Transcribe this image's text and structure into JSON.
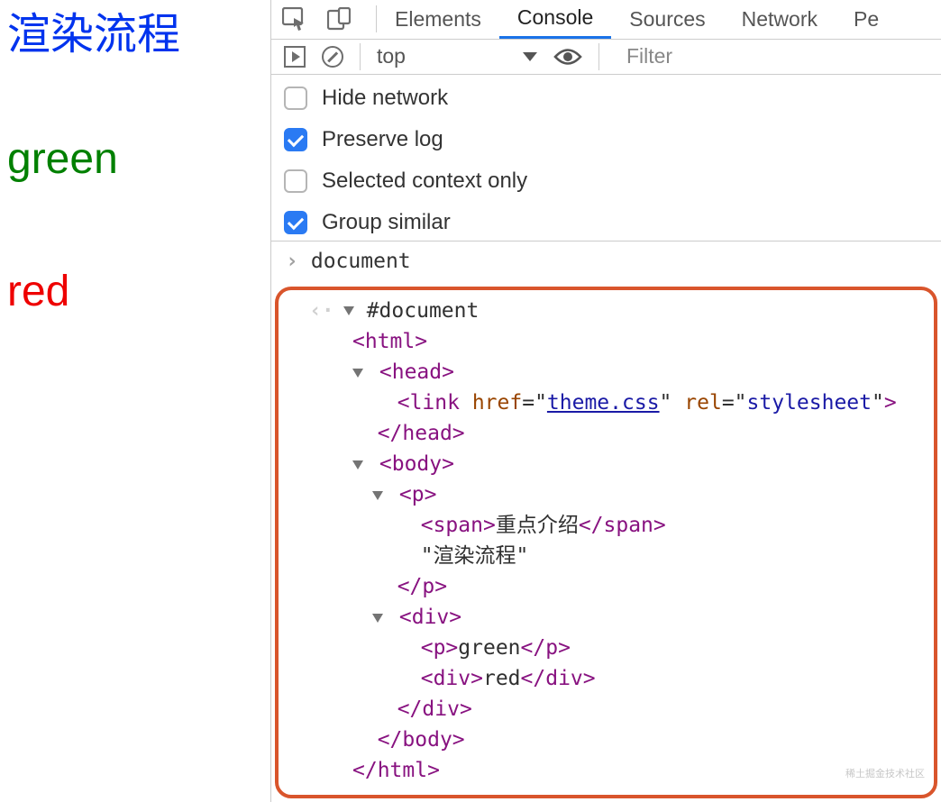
{
  "page": {
    "title": "渲染流程",
    "green": "green",
    "red": "red"
  },
  "tabs": {
    "elements": "Elements",
    "console": "Console",
    "sources": "Sources",
    "network": "Network",
    "performance": "Pe"
  },
  "subbar": {
    "context": "top",
    "filter_placeholder": "Filter"
  },
  "options": {
    "hide_network": "Hide network",
    "preserve_log": "Preserve log",
    "selected_context_only": "Selected context only",
    "group_similar": "Group similar"
  },
  "console": {
    "input": "document",
    "return_root": "#document",
    "dom": {
      "html_open": "html",
      "head_open": "head",
      "link_tag": "link",
      "link_href_attr": "href",
      "link_href_val": "theme.css",
      "link_rel_attr": "rel",
      "link_rel_val": "stylesheet",
      "head_close": "head",
      "body_open": "body",
      "p_open": "p",
      "span_open": "span",
      "span_text": "重点介绍",
      "span_close": "span",
      "p_text": "\"渲染流程\"",
      "p_close": "p",
      "div_open": "div",
      "inner_p_open": "p",
      "inner_p_text": "green",
      "inner_p_close": "p",
      "inner_div_open": "div",
      "inner_div_text": "red",
      "inner_div_close": "div",
      "div_close": "div",
      "body_close": "body",
      "html_close": "html"
    }
  },
  "watermark": "稀土掘金技术社区"
}
